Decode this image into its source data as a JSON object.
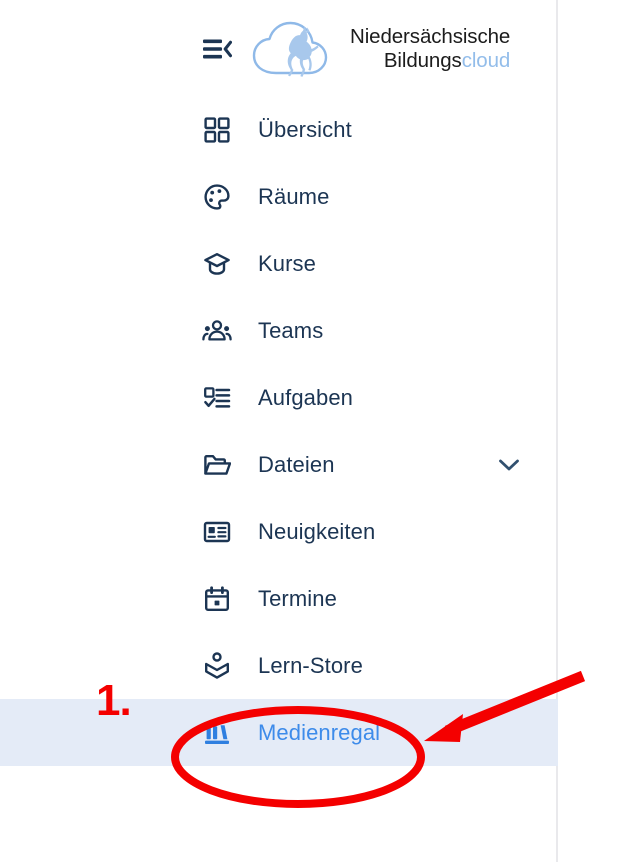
{
  "brand": {
    "logo_icon": "cloud-horse-logo",
    "line1": "Niedersächsische",
    "line2_dark": "Bildungs",
    "line2_accent": "cloud",
    "accent_color": "#93bdea",
    "text_color": "#1c1c1c"
  },
  "toggle": {
    "icon": "menu-collapse-icon",
    "label": "Navigation einklappen"
  },
  "nav": {
    "active_label": "Medienregal",
    "active_bg": "#e4ebf7",
    "active_text_color": "#3d8bea",
    "default_text_color": "#1c3553",
    "items": [
      {
        "label": "Übersicht",
        "icon": "grid-squares-icon",
        "expandable": false,
        "active": false
      },
      {
        "label": "Räume",
        "icon": "palette-face-icon",
        "expandable": false,
        "active": false
      },
      {
        "label": "Kurse",
        "icon": "graduation-cap-icon",
        "expandable": false,
        "active": false
      },
      {
        "label": "Teams",
        "icon": "people-group-icon",
        "expandable": false,
        "active": false
      },
      {
        "label": "Aufgaben",
        "icon": "task-checklist-icon",
        "expandable": false,
        "active": false
      },
      {
        "label": "Dateien",
        "icon": "folder-open-icon",
        "expandable": true,
        "active": false
      },
      {
        "label": "Neuigkeiten",
        "icon": "news-card-icon",
        "expandable": false,
        "active": false
      },
      {
        "label": "Termine",
        "icon": "calendar-icon",
        "expandable": false,
        "active": false
      },
      {
        "label": "Lern-Store",
        "icon": "open-book-person-icon",
        "expandable": false,
        "active": false
      },
      {
        "label": "Medienregal",
        "icon": "bookshelf-icon",
        "expandable": false,
        "active": true
      }
    ]
  },
  "annotations": {
    "color": "#f40000",
    "step_label": "1.",
    "highlight_shape": "ellipse",
    "highlight_target": "Medienregal",
    "pointer_shape": "arrow",
    "pointer_target": "Medienregal"
  }
}
